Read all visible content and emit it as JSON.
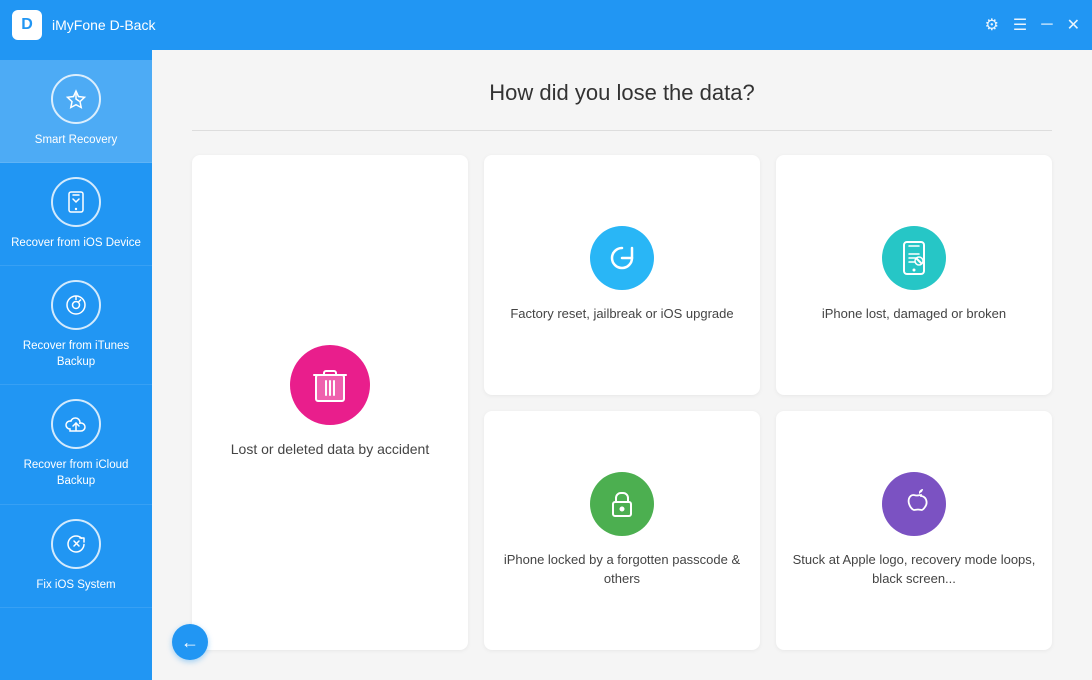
{
  "titlebar": {
    "logo": "D",
    "title": "iMyFone D-Back",
    "settings_icon": "⚙",
    "menu_icon": "☰",
    "minimize_icon": "─",
    "close_icon": "✕"
  },
  "sidebar": {
    "items": [
      {
        "id": "smart-recovery",
        "label": "Smart Recovery",
        "icon": "⚡",
        "active": true
      },
      {
        "id": "ios-device",
        "label": "Recover from\niOS Device",
        "icon": "📱",
        "active": false
      },
      {
        "id": "itunes-backup",
        "label": "Recover from\niTunes Backup",
        "icon": "🎵",
        "active": false
      },
      {
        "id": "icloud-backup",
        "label": "Recover from\niCloud Backup",
        "icon": "☁",
        "active": false
      },
      {
        "id": "fix-ios",
        "label": "Fix iOS System",
        "icon": "🔧",
        "active": false
      }
    ]
  },
  "content": {
    "title": "How did you lose the data?",
    "cards": [
      {
        "id": "lost-deleted",
        "icon": "🗑",
        "icon_color": "icon-pink",
        "label": "Lost or deleted data by accident",
        "large": true
      },
      {
        "id": "factory-reset",
        "icon": "↺",
        "icon_color": "icon-blue",
        "label": "Factory reset, jailbreak or iOS upgrade",
        "large": false
      },
      {
        "id": "iphone-lost",
        "icon": "📱",
        "icon_color": "icon-teal",
        "label": "iPhone lost, damaged or broken",
        "large": false
      },
      {
        "id": "iphone-locked",
        "icon": "🔒",
        "icon_color": "icon-green",
        "label": "iPhone locked by a forgotten passcode & others",
        "large": false
      },
      {
        "id": "stuck-apple",
        "icon": "",
        "icon_color": "icon-purple",
        "label": "Stuck at Apple logo, recovery mode loops, black screen...",
        "large": false
      }
    ],
    "back_icon": "←"
  }
}
